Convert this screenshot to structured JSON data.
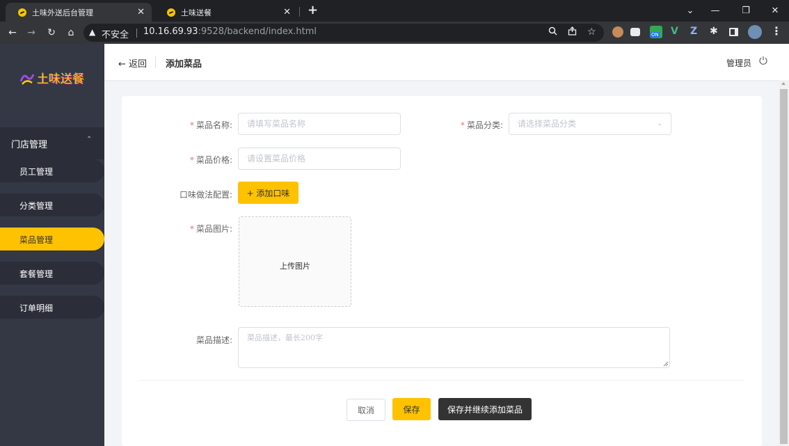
{
  "browser": {
    "tabs": [
      {
        "title": "土味外送后台管理",
        "close": "✕"
      },
      {
        "title": "土味送餐",
        "close": "✕"
      }
    ],
    "new_tab": "+",
    "window_controls": {
      "dropdown": "⌄",
      "minimize": "—",
      "restore": "❐",
      "close": "✕"
    },
    "nav": {
      "back": "←",
      "forward": "→",
      "reload": "↻",
      "home": "⌂"
    },
    "omnibox": {
      "warning_icon": "warning-triangle-icon",
      "insecure_label": "不安全",
      "host": "10.16.69.93",
      "rest": ":9528/backend/index.html"
    },
    "extensions": [
      "zoom-icon",
      "share-icon",
      "star-icon",
      "extension-avatar",
      "camera-icon",
      "on-badge-icon",
      "vue-devtools-icon",
      "z-icon",
      "puzzle-icon",
      "sidepanel-icon",
      "profile-avatar",
      "kebab-menu-icon"
    ],
    "ext_on_label": "ON"
  },
  "sidebar": {
    "logo_text": "土味送餐",
    "group_label": "门店管理",
    "group_arrow": "⌃",
    "items": [
      {
        "label": "员工管理",
        "active": false
      },
      {
        "label": "分类管理",
        "active": false
      },
      {
        "label": "菜品管理",
        "active": true
      },
      {
        "label": "套餐管理",
        "active": false
      },
      {
        "label": "订单明细",
        "active": false
      }
    ]
  },
  "header": {
    "back_label": "← 返回",
    "title": "添加菜品",
    "user_label": "管理员"
  },
  "form": {
    "required_mark": "*",
    "name": {
      "label": "菜品名称:",
      "placeholder": "请填写菜品名称"
    },
    "category": {
      "label": "菜品分类:",
      "placeholder": "请选择菜品分类",
      "arrow": "⌄"
    },
    "price": {
      "label": "菜品价格:",
      "placeholder": "请设置菜品价格"
    },
    "flavor": {
      "label": "口味做法配置:",
      "button": "+ 添加口味"
    },
    "image": {
      "label": "菜品图片:",
      "upload_text": "上传图片"
    },
    "description": {
      "label": "菜品描述:",
      "placeholder": "菜品描述，最长200字"
    }
  },
  "actions": {
    "cancel": "取消",
    "save": "保存",
    "save_continue": "保存并继续添加菜品"
  },
  "colors": {
    "accent": "#ffc200",
    "sidebar_bg": "#343744",
    "menu_item_bg": "#2b2e39",
    "dark_button": "#333333",
    "required": "#f56c6c"
  }
}
